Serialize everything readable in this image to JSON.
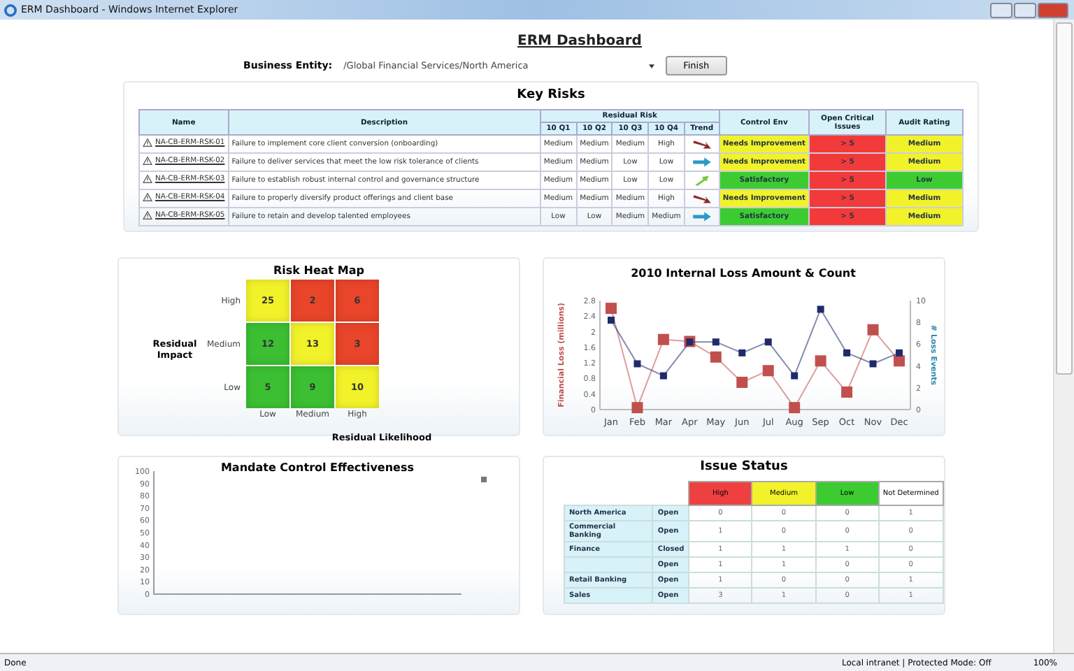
{
  "window": {
    "title": "ERM Dashboard - Windows Internet Explorer"
  },
  "page_title": "ERM Dashboard",
  "entity": {
    "label": "Business Entity:",
    "value": "/Global Financial Services/North America",
    "button": "Finish"
  },
  "key_risks": {
    "title": "Key Risks",
    "group_header": "Residual Risk",
    "columns": [
      "Name",
      "Description",
      "10 Q1",
      "10 Q2",
      "10 Q3",
      "10 Q4",
      "Trend",
      "Control Env",
      "Open Critical Issues",
      "Audit Rating"
    ],
    "rows": [
      {
        "name": "NA-CB-ERM-RSK-01",
        "description": "Failure to implement core client conversion (onboarding)",
        "q": [
          "Medium",
          "Medium",
          "Medium",
          "High"
        ],
        "trend": {
          "kind": "down"
        },
        "control_env": {
          "text": "Needs Improvement",
          "color": "#f2f22a"
        },
        "issues": {
          "text": "> 5",
          "color": "#f23a3a"
        },
        "audit": {
          "text": "Medium",
          "color": "#f2f22a"
        }
      },
      {
        "name": "NA-CB-ERM-RSK-02",
        "description": "Failure to deliver services that meet the low risk tolerance of clients",
        "q": [
          "Medium",
          "Medium",
          "Low",
          "Low"
        ],
        "trend": {
          "kind": "flat"
        },
        "control_env": {
          "text": "Needs Improvement",
          "color": "#f2f22a"
        },
        "issues": {
          "text": "> 5",
          "color": "#f23a3a"
        },
        "audit": {
          "text": "Medium",
          "color": "#f2f22a"
        }
      },
      {
        "name": "NA-CB-ERM-RSK-03",
        "description": "Failure to establish robust internal control and governance structure",
        "q": [
          "Medium",
          "Medium",
          "Low",
          "Low"
        ],
        "trend": {
          "kind": "up"
        },
        "control_env": {
          "text": "Satisfactory",
          "color": "#3ccc32"
        },
        "issues": {
          "text": "> 5",
          "color": "#f23a3a"
        },
        "audit": {
          "text": "Low",
          "color": "#3ccc32"
        }
      },
      {
        "name": "NA-CB-ERM-RSK-04",
        "description": "Failure to properly diversify product offerings and client base",
        "q": [
          "Medium",
          "Medium",
          "Medium",
          "High"
        ],
        "trend": {
          "kind": "down"
        },
        "control_env": {
          "text": "Needs Improvement",
          "color": "#f2f22a"
        },
        "issues": {
          "text": "> 5",
          "color": "#f23a3a"
        },
        "audit": {
          "text": "Medium",
          "color": "#f2f22a"
        }
      },
      {
        "name": "NA-CB-ERM-RSK-05",
        "description": "Failure to retain and develop talented employees",
        "q": [
          "Low",
          "Low",
          "Medium",
          "Medium"
        ],
        "trend": {
          "kind": "flat"
        },
        "control_env": {
          "text": "Satisfactory",
          "color": "#3ccc32"
        },
        "issues": {
          "text": "> 5",
          "color": "#f23a3a"
        },
        "audit": {
          "text": "Medium",
          "color": "#f2f22a"
        }
      }
    ]
  },
  "heat_map": {
    "title": "Risk Heat Map",
    "y_title": "Residual Impact",
    "x_title": "Residual Likelihood",
    "x_labels": [
      "Low",
      "Medium",
      "High"
    ],
    "rows": [
      {
        "label": "High",
        "cells": [
          {
            "value": "25",
            "color": "#f2f22a"
          },
          {
            "value": "2",
            "color": "#e8452a"
          },
          {
            "value": "6",
            "color": "#e8452a"
          }
        ]
      },
      {
        "label": "Medium",
        "cells": [
          {
            "value": "12",
            "color": "#3cbf32"
          },
          {
            "value": "13",
            "color": "#f2f22a"
          },
          {
            "value": "3",
            "color": "#e8452a"
          }
        ]
      },
      {
        "label": "Low",
        "cells": [
          {
            "value": "5",
            "color": "#3cbf32"
          },
          {
            "value": "9",
            "color": "#3cbf32"
          },
          {
            "value": "10",
            "color": "#f2f22a"
          }
        ]
      }
    ]
  },
  "loss_chart": {
    "chart_data": {
      "type": "line",
      "title": "2010 Internal Loss Amount & Count",
      "ylabel": "Financial Loss (millions)",
      "y2label": "# Loss Events",
      "categories": [
        "Jan",
        "Feb",
        "Mar",
        "Apr",
        "May",
        "Jun",
        "Jul",
        "Aug",
        "Sep",
        "Oct",
        "Nov",
        "Dec"
      ],
      "ylim": [
        0,
        2.8
      ],
      "yticks": [
        0,
        0.4,
        0.8,
        1.2,
        1.6,
        2,
        2.4,
        2.8
      ],
      "y2lim": [
        0,
        10
      ],
      "y2ticks": [
        0,
        2,
        4,
        6,
        8,
        10
      ],
      "series": [
        {
          "color": "#c0504d",
          "marker": "square",
          "values": [
            2.6,
            0.05,
            1.8,
            1.75,
            1.35,
            0.7,
            1.0,
            0.05,
            1.25,
            0.45,
            2.05,
            1.25
          ]
        },
        {
          "color": "#1f2a6b",
          "axis": "y2",
          "marker": "square",
          "values": [
            8.2,
            4.2,
            3.1,
            6.2,
            6.2,
            5.2,
            6.2,
            3.1,
            9.2,
            5.2,
            4.2,
            5.2
          ]
        }
      ]
    }
  },
  "mandate_chart": {
    "title": "Mandate Control Effectiveness",
    "y_axis_labels": [
      "100",
      "90",
      "80",
      "70",
      "60",
      "50",
      "40",
      "30",
      "20",
      "10",
      "0"
    ]
  },
  "issue_status": {
    "title": "Issue Status",
    "columns": [
      {
        "label": "High",
        "color": "#ee4040"
      },
      {
        "label": "Medium",
        "color": "#f2f22a"
      },
      {
        "label": "Low",
        "color": "#3ccc32"
      },
      {
        "label": "Not Determined",
        "color": "#ffffff"
      }
    ],
    "rows": [
      {
        "group": "North America",
        "status": "Open",
        "values": [
          "0",
          "0",
          "0",
          "1"
        ]
      },
      {
        "group": "Commercial Banking",
        "status": "Open",
        "values": [
          "1",
          "0",
          "0",
          "0"
        ]
      },
      {
        "group": "Finance",
        "status": "Closed",
        "values": [
          "1",
          "1",
          "1",
          "0"
        ]
      },
      {
        "status": "Open",
        "values": [
          "1",
          "1",
          "0",
          "0"
        ]
      },
      {
        "group": "Retail Banking",
        "status": "Open",
        "values": [
          "1",
          "0",
          "0",
          "1"
        ]
      },
      {
        "group": "Sales",
        "status": "Open",
        "values": [
          "3",
          "1",
          "0",
          "1"
        ]
      }
    ]
  },
  "status_bar": {
    "left": "Done",
    "zone": "Local intranet | Protected Mode: Off",
    "zoom": "100%"
  }
}
